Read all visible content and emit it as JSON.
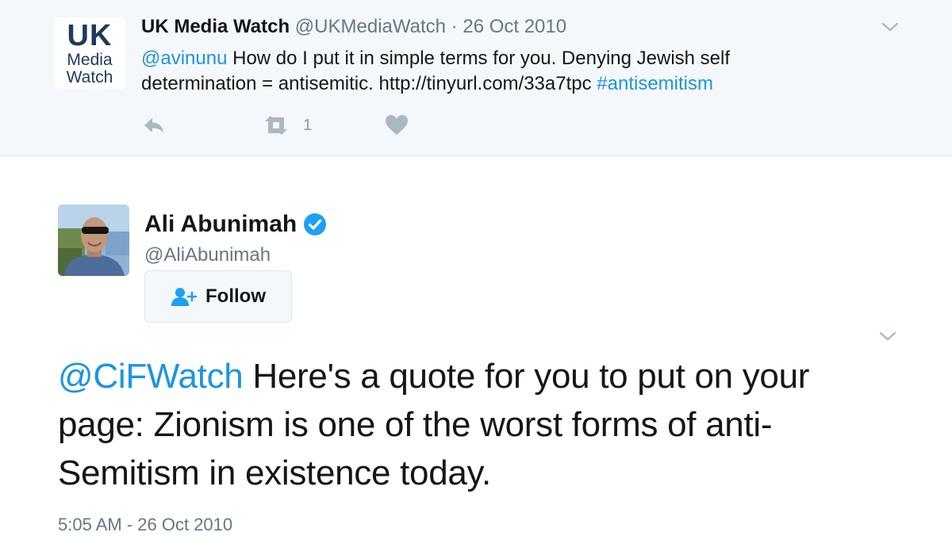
{
  "parent_tweet": {
    "logo": {
      "line1": "UK",
      "line2": "Media",
      "line3": "Watch"
    },
    "name": "UK Media Watch",
    "handle": "@UKMediaWatch",
    "separator": "·",
    "date": "26 Oct 2010",
    "text_mention": "@avinunu",
    "text_body": " How do I put it in simple terms for you. Denying Jewish self determination = antisemitic. http://tinyurl.com/33a7tpc ",
    "text_hashtag": "#antisemitism",
    "retweet_count": "1",
    "icons": {
      "reply": "reply-icon",
      "retweet": "retweet-icon",
      "like": "heart-icon",
      "more": "chevron-down-icon"
    }
  },
  "main_tweet": {
    "name": "Ali Abunimah",
    "handle": "@AliAbunimah",
    "follow_label": "Follow",
    "text_mention": "@CiFWatch",
    "text_body": " Here's a quote for you to put on your page: Zionism is one of the worst forms of anti-Semitism in existence today.",
    "timestamp": "5:05 AM - 26 Oct 2010",
    "icons": {
      "verified": "verified-badge-icon",
      "follow": "add-user-icon",
      "more": "chevron-down-icon"
    }
  },
  "colors": {
    "link": "#1b95e0",
    "secondary_text": "#657786",
    "action_icon": "#aab8c2",
    "parent_background": "#f5f8fa",
    "logo_text": "#1e3a5c"
  }
}
